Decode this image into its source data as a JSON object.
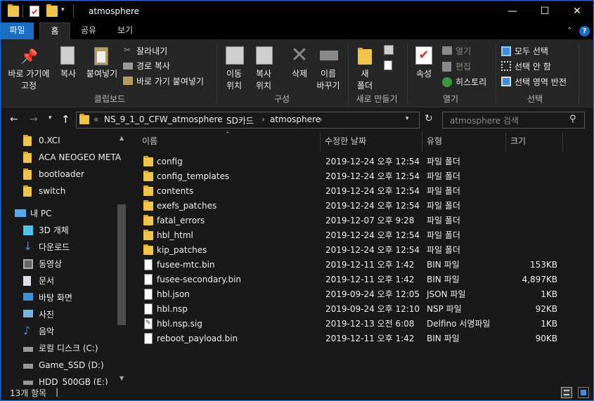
{
  "window": {
    "title": "atmosphere",
    "minimize": "—",
    "maximize": "☐",
    "close": "✕"
  },
  "ribbon_tabs": [
    "파일",
    "홈",
    "공유",
    "보기"
  ],
  "ribbon": {
    "pin": "바로 가기에\n고정",
    "copy": "복사",
    "paste": "붙여넣기",
    "cut": "잘라내기",
    "copy_path": "경로 복사",
    "paste_shortcut": "바로 가기 붙여넣기",
    "clipboard_group": "클립보드",
    "move_to": "이동\n위치",
    "copy_to": "복사\n위치",
    "delete": "삭제",
    "rename": "이름\n바꾸기",
    "organize_group": "구성",
    "new_folder": "새\n폴더",
    "new_group": "새로 만들기",
    "properties": "속성",
    "open": "열기",
    "edit": "편집",
    "history": "히스토리",
    "open_group": "열기",
    "select_all": "모두 선택",
    "select_none": "선택 안 함",
    "invert_selection": "선택 영역 반전",
    "select_group": "선택"
  },
  "address": {
    "overflow": "«",
    "crumbs": [
      "NS_9_1_0_CFW_atmosphere",
      "SD카드",
      "atmosphere"
    ],
    "search_placeholder": "atmosphere 검색"
  },
  "nav": [
    {
      "label": "0.XCI",
      "icon": "folder-icon"
    },
    {
      "label": "ACA NEOGEO META",
      "icon": "folder-icon"
    },
    {
      "label": "bootloader",
      "icon": "folder-icon"
    },
    {
      "label": "switch",
      "icon": "folder-icon"
    },
    {
      "label": "내 PC",
      "icon": "pc-icon"
    },
    {
      "label": "3D 개체",
      "icon": "3d-objects-icon"
    },
    {
      "label": "다운로드",
      "icon": "download-icon"
    },
    {
      "label": "동영상",
      "icon": "video-icon"
    },
    {
      "label": "문서",
      "icon": "document-icon"
    },
    {
      "label": "바탕 화면",
      "icon": "desktop-icon"
    },
    {
      "label": "사진",
      "icon": "picture-icon"
    },
    {
      "label": "음악",
      "icon": "music-icon"
    },
    {
      "label": "로컬 디스크 (C:)",
      "icon": "drive-icon"
    },
    {
      "label": "Game_SSD (D:)",
      "icon": "drive-icon"
    },
    {
      "label": "HDD_500GB (E:)",
      "icon": "drive-icon"
    }
  ],
  "columns": {
    "name": "이름",
    "modified": "수정한 날짜",
    "type": "유형",
    "size": "크기"
  },
  "files": [
    {
      "name": "config",
      "date": "2019-12-24 오후 12:54",
      "type": "파일 폴더",
      "size": "",
      "kind": "folder"
    },
    {
      "name": "config_templates",
      "date": "2019-12-24 오후 12:54",
      "type": "파일 폴더",
      "size": "",
      "kind": "folder"
    },
    {
      "name": "contents",
      "date": "2019-12-24 오후 12:54",
      "type": "파일 폴더",
      "size": "",
      "kind": "folder"
    },
    {
      "name": "exefs_patches",
      "date": "2019-12-24 오후 12:54",
      "type": "파일 폴더",
      "size": "",
      "kind": "folder"
    },
    {
      "name": "fatal_errors",
      "date": "2019-12-07 오후 9:28",
      "type": "파일 폴더",
      "size": "",
      "kind": "folder"
    },
    {
      "name": "hbl_html",
      "date": "2019-12-24 오후 12:54",
      "type": "파일 폴더",
      "size": "",
      "kind": "folder"
    },
    {
      "name": "kip_patches",
      "date": "2019-12-24 오후 12:54",
      "type": "파일 폴더",
      "size": "",
      "kind": "folder"
    },
    {
      "name": "fusee-mtc.bin",
      "date": "2019-12-11 오후 1:42",
      "type": "BIN 파일",
      "size": "153KB",
      "kind": "file"
    },
    {
      "name": "fusee-secondary.bin",
      "date": "2019-12-11 오후 1:42",
      "type": "BIN 파일",
      "size": "4,897KB",
      "kind": "file"
    },
    {
      "name": "hbl.json",
      "date": "2019-09-24 오후 12:05",
      "type": "JSON 파일",
      "size": "1KB",
      "kind": "file"
    },
    {
      "name": "hbl.nsp",
      "date": "2019-09-24 오후 12:10",
      "type": "NSP 파일",
      "size": "92KB",
      "kind": "file"
    },
    {
      "name": "hbl.nsp.sig",
      "date": "2019-12-13 오전 6:08",
      "type": "Delfino 서명파일",
      "size": "1KB",
      "kind": "sig"
    },
    {
      "name": "reboot_payload.bin",
      "date": "2019-12-11 오후 1:42",
      "type": "BIN 파일",
      "size": "90KB",
      "kind": "file"
    }
  ],
  "status": {
    "count": "13개 항목"
  }
}
